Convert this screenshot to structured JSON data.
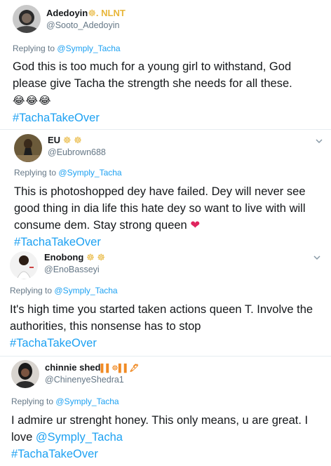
{
  "tweets": [
    {
      "name": "Adedoyin",
      "name_suffix": "☸. NLNT",
      "handle": "@Sooto_Adedoyin",
      "replying_label": "Replying to",
      "replying_to": "@Symply_Tacha",
      "text": "God this is too much for a young girl to withstand, God please give Tacha the strength she needs for all these.",
      "emoji": "😂😂😂",
      "hashtag": "#TachaTakeOver"
    },
    {
      "name": "EU",
      "name_suffix": "☸ ☸",
      "handle": "@Eubrown688",
      "replying_label": "Replying to",
      "replying_to": "@Symply_Tacha",
      "text": "This is photoshopped dey have failed. Dey will never see good thing in dia life this hate dey so want to live with will consume dem. Stay strong queen",
      "emoji": "❤",
      "hashtag": "#TachaTakeOver"
    },
    {
      "name": "Enobong",
      "name_suffix": "☸ ☸",
      "handle": "@EnoBasseyi",
      "replying_label": "Replying to",
      "replying_to": "@Symply_Tacha",
      "text": "It's high time you started taken actions queen T. Involve the authorities, this nonsense has to stop",
      "hashtag": "#TachaTakeOver"
    },
    {
      "name": "chinnie shed",
      "name_suffix": "▌▌☸▌▌🖋",
      "handle": "@ChinenyeShedra1",
      "replying_label": "Replying to",
      "replying_to": "@Symply_Tacha",
      "text": "I admire ur strenght honey. This only means, u are great. I love",
      "mention": "@Symply_Tacha",
      "hashtag": "#TachaTakeOver"
    }
  ],
  "colors": {
    "link": "#1da1f2",
    "muted": "#657786",
    "heart": "#e0245e"
  },
  "icons": [
    "chevron-down-icon",
    "avatar"
  ]
}
